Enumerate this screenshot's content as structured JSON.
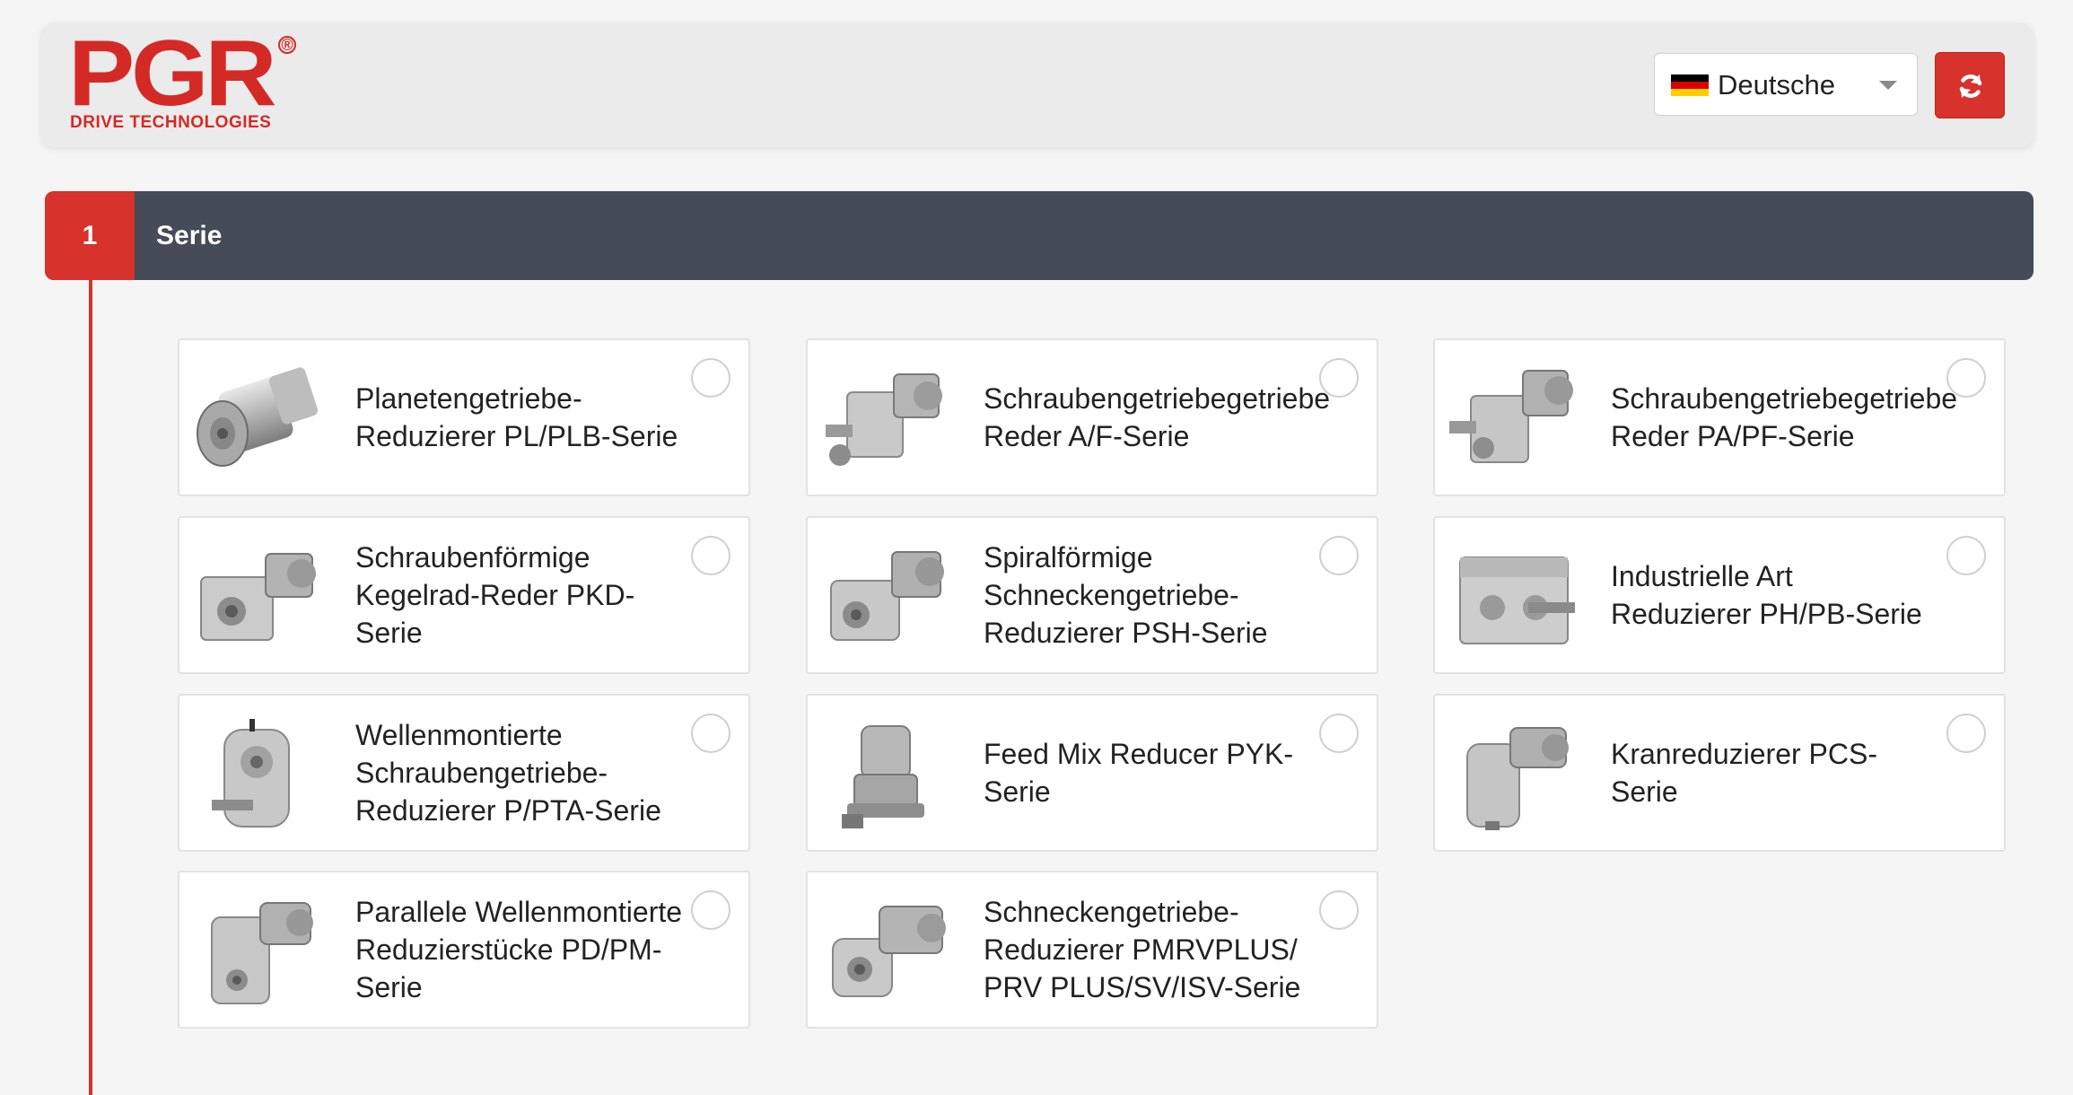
{
  "header": {
    "logo_text": "PGR",
    "logo_registered": "®",
    "logo_subtitle": "DRIVE TECHNOLOGIES",
    "language": {
      "selected": "Deutsche",
      "flag": "german-flag-icon"
    },
    "refresh_icon": "refresh-icon"
  },
  "step": {
    "number": "1",
    "title": "Serie"
  },
  "colors": {
    "accent": "#d7322b",
    "bar": "#454b57",
    "background": "#f5f5f5"
  },
  "series": [
    {
      "label": "Planetengetriebe-\nReduzierer PL/PLB-Serie",
      "icon": "planetary-gearbox-image"
    },
    {
      "label": "Schraubengetriebegetriebe\nReder A/F-Serie",
      "icon": "helical-gearbox-image"
    },
    {
      "label": "Schraubengetriebegetriebe\nReder PA/PF-Serie",
      "icon": "helical-gearbox-image"
    },
    {
      "label": "Schraubenförmige\nKegelrad-Reder PKD-\nSerie",
      "icon": "bevel-gearbox-image"
    },
    {
      "label": "Spiralförmige\nSchneckengetriebe-\nReduzierer PSH-Serie",
      "icon": "worm-gearbox-image"
    },
    {
      "label": "Industrielle Art\nReduzierer PH/PB-Serie",
      "icon": "industrial-gearbox-image"
    },
    {
      "label": "Wellenmontierte\nSchraubengetriebe-\nReduzierer P/PTA-Serie",
      "icon": "shaft-mounted-gearbox-image"
    },
    {
      "label": "Feed Mix Reducer PYK-\nSerie",
      "icon": "feed-mix-reducer-image"
    },
    {
      "label": "Kranreduzierer PCS-\nSerie",
      "icon": "crane-reducer-image"
    },
    {
      "label": "Parallele Wellenmontierte\nReduzierstücke PD/PM-\nSerie",
      "icon": "parallel-shaft-gearbox-image"
    },
    {
      "label": "Schneckengetriebe-\nReduzierer PMRVPLUS/\nPRV PLUS/SV/ISV-Serie",
      "icon": "worm-gearbox-image"
    }
  ]
}
